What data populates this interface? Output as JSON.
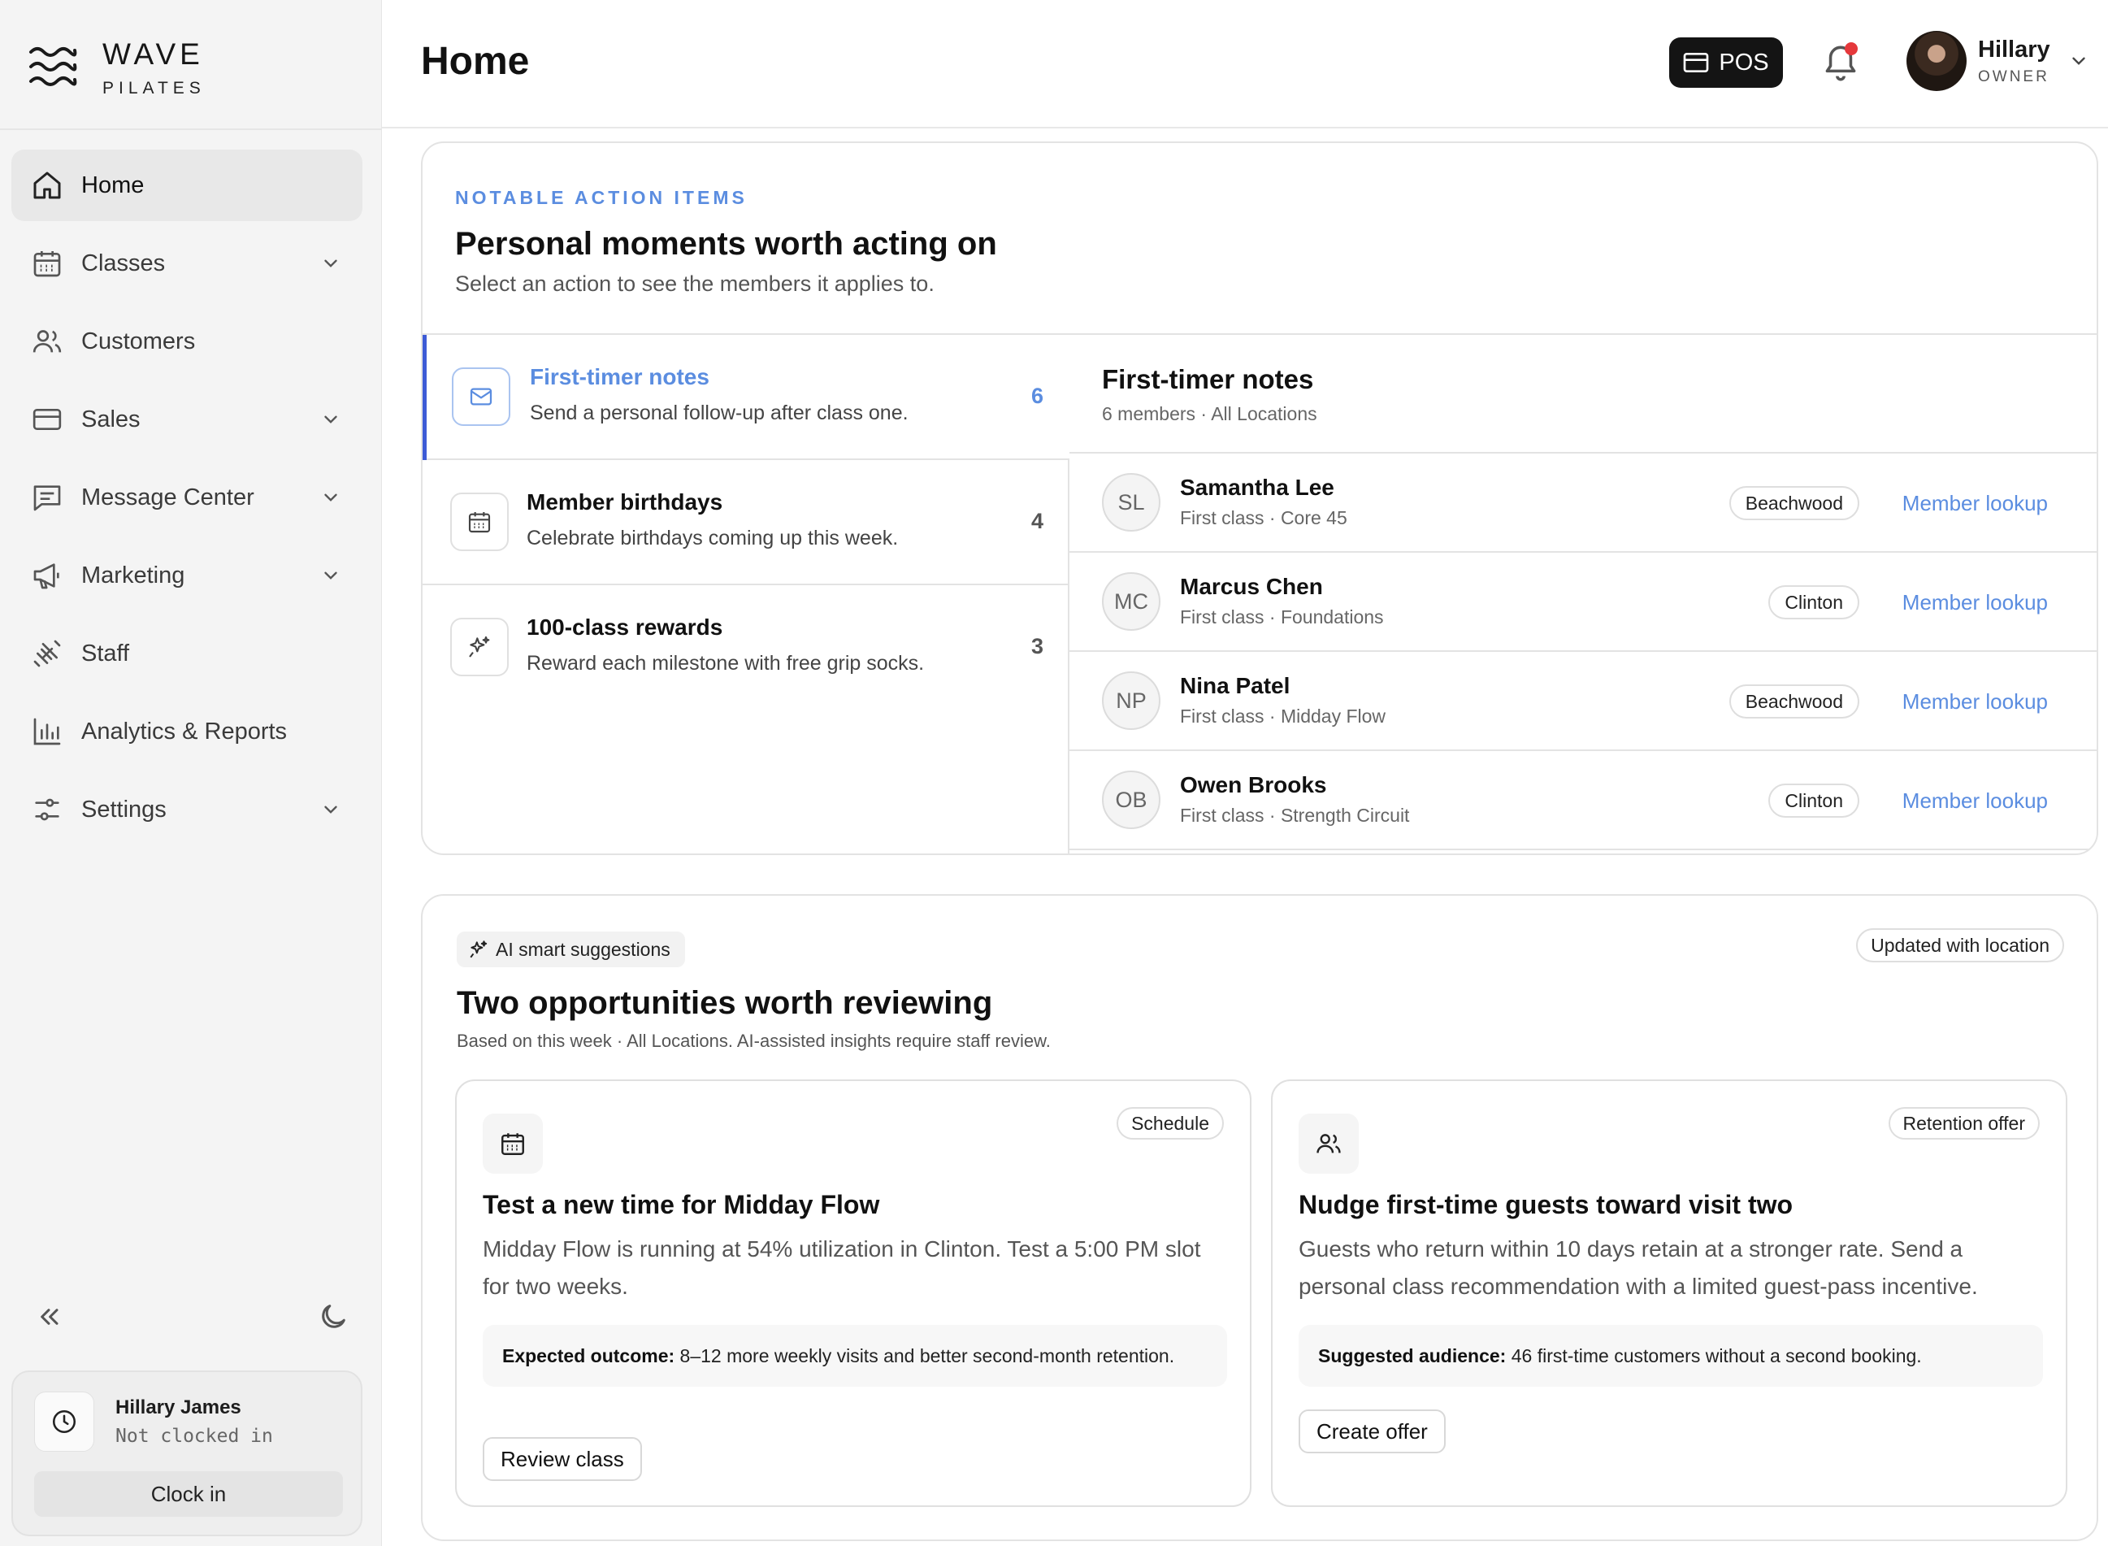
{
  "brand": {
    "name": "WAVE",
    "sub": "PILATES"
  },
  "sidebar": {
    "items": [
      {
        "label": "Home",
        "icon": "home-icon",
        "active": true
      },
      {
        "label": "Classes",
        "icon": "calendar-icon",
        "expandable": true
      },
      {
        "label": "Customers",
        "icon": "users-icon"
      },
      {
        "label": "Sales",
        "icon": "credit-card-icon",
        "expandable": true
      },
      {
        "label": "Message Center",
        "icon": "message-icon",
        "expandable": true
      },
      {
        "label": "Marketing",
        "icon": "megaphone-icon",
        "expandable": true
      },
      {
        "label": "Staff",
        "icon": "dumbbell-icon"
      },
      {
        "label": "Analytics & Reports",
        "icon": "bar-chart-icon"
      },
      {
        "label": "Settings",
        "icon": "sliders-icon",
        "expandable": true
      }
    ],
    "clock": {
      "name": "Hillary James",
      "status": "Not clocked in",
      "button": "Clock in"
    }
  },
  "header": {
    "title": "Home",
    "pos_label": "POS",
    "user": {
      "name": "Hillary",
      "role": "OWNER"
    }
  },
  "actions_panel": {
    "eyebrow": "NOTABLE ACTION ITEMS",
    "title": "Personal moments worth acting on",
    "subtitle": "Select an action to see the members it applies to.",
    "actions": [
      {
        "title": "First-timer notes",
        "desc": "Send a personal follow-up after class one.",
        "count": "6",
        "icon": "mail-icon",
        "selected": true
      },
      {
        "title": "Member birthdays",
        "desc": "Celebrate birthdays coming up this week.",
        "count": "4",
        "icon": "calendar-icon"
      },
      {
        "title": "100-class rewards",
        "desc": "Reward each milestone with free grip socks.",
        "count": "3",
        "icon": "sparkle-icon"
      }
    ],
    "members_title": "First-timer notes",
    "members_sub": "6 members · All Locations",
    "members": [
      {
        "initials": "SL",
        "name": "Samantha Lee",
        "detail": "First class · Core 45",
        "location": "Beachwood",
        "link": "Member lookup"
      },
      {
        "initials": "MC",
        "name": "Marcus Chen",
        "detail": "First class · Foundations",
        "location": "Clinton",
        "link": "Member lookup"
      },
      {
        "initials": "NP",
        "name": "Nina Patel",
        "detail": "First class · Midday Flow",
        "location": "Beachwood",
        "link": "Member lookup"
      },
      {
        "initials": "OB",
        "name": "Owen Brooks",
        "detail": "First class · Strength Circuit",
        "location": "Clinton",
        "link": "Member lookup"
      }
    ]
  },
  "suggestions_panel": {
    "chip": "AI smart suggestions",
    "updated": "Updated with location",
    "title": "Two opportunities worth reviewing",
    "subtitle": "Based on this week · All Locations. AI-assisted insights require staff review.",
    "cards": [
      {
        "tag": "Schedule",
        "title": "Test a new time for Midday Flow",
        "desc": "Midday Flow is running at 54% utilization in Clinton. Test a 5:00 PM slot for two weeks.",
        "box_label": "Expected outcome:",
        "box_text": " 8–12 more weekly visits and better second-month retention.",
        "button": "Review class"
      },
      {
        "tag": "Retention offer",
        "title": "Nudge first-time guests toward visit two",
        "desc": "Guests who return within 10 days retain at a stronger rate. Send a personal class recommendation with a limited guest-pass incentive.",
        "box_label": "Suggested audience:",
        "box_text": " 46 first-time customers without a second booking.",
        "button": "Create offer"
      }
    ]
  },
  "colors": {
    "accent": "#5b8de0",
    "selected_bar": "#3d5bd6",
    "notification": "#e5383b"
  }
}
